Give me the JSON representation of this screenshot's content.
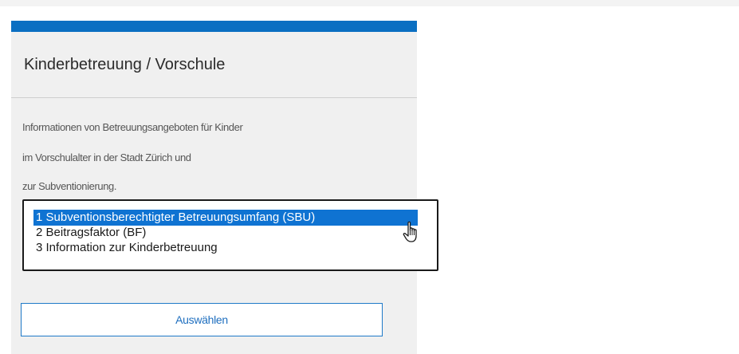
{
  "card": {
    "title": "Kinderbetreuung / Vorschule",
    "accent_color": "#0a6fc2",
    "description_lines": [
      "Informationen von Betreuungsangeboten für Kinder",
      "im Vorschulalter in der Stadt Zürich und",
      "zur Subventionierung."
    ]
  },
  "listbox": {
    "options": [
      "1 Subventionsberechtigter Betreuungsumfang (SBU)",
      "2 Beitragsfaktor (BF)",
      "3 Information zur Kinderbetreuung"
    ],
    "selected_option": "1 Subventionsberechtigter Betreuungsumfang (SBU)",
    "selection_color": "#0f73d2"
  },
  "cursor": {
    "icon": "hand-pointer-icon"
  },
  "actions": {
    "select_label": "Auswählen"
  }
}
